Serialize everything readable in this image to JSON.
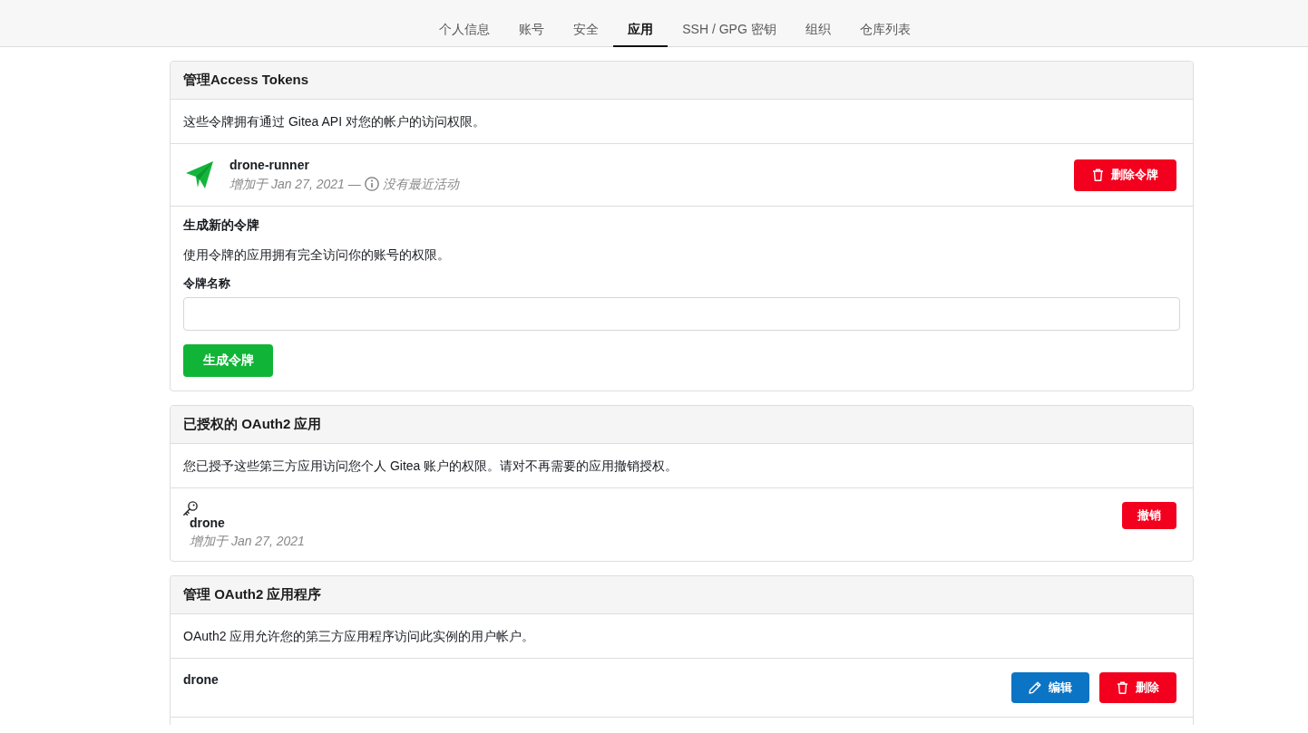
{
  "nav_tabs": [
    {
      "label": "个人信息",
      "selected": false
    },
    {
      "label": "账号",
      "selected": false
    },
    {
      "label": "安全",
      "selected": false
    },
    {
      "label": "应用",
      "selected": true
    },
    {
      "label": "SSH / GPG 密钥",
      "selected": false
    },
    {
      "label": "组织",
      "selected": false
    },
    {
      "label": "仓库列表",
      "selected": false
    }
  ],
  "access_tokens": {
    "title": "管理Access Tokens",
    "description": "这些令牌拥有通过 Gitea API 对您的帐户的访问权限。",
    "tokens": [
      {
        "name": "drone-runner",
        "added": "增加于 Jan 27, 2021 —",
        "activity": "没有最近活动",
        "delete_button": "删除令牌"
      }
    ],
    "new_token": {
      "heading": "生成新的令牌",
      "description": "使用令牌的应用拥有完全访问你的账号的权限。",
      "name_label": "令牌名称",
      "generate_button": "生成令牌"
    }
  },
  "authorized_oauth2": {
    "title": "已授权的 OAuth2 应用",
    "description": "您已授予这些第三方应用访问您个人 Gitea 账户的权限。请对不再需要的应用撤销授权。",
    "apps": [
      {
        "name": "drone",
        "added": "增加于 Jan 27, 2021",
        "revoke_button": "撤销"
      }
    ]
  },
  "oauth2_applications": {
    "title": "管理 OAuth2 应用程序",
    "description": "OAuth2 应用允许您的第三方应用程序访问此实例的用户帐户。",
    "apps": [
      {
        "name": "drone",
        "edit_button": "编辑",
        "delete_button": "删除"
      }
    ]
  }
}
